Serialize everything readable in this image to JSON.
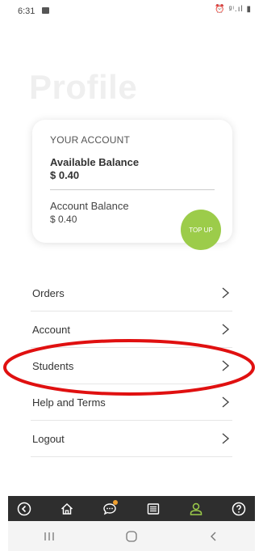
{
  "status_bar": {
    "time": "6:31",
    "right_icons": "⏰ ᵍᶦ.ıl ▮"
  },
  "page": {
    "title": "Profile"
  },
  "account_card": {
    "heading": "YOUR ACCOUNT",
    "available_balance_label": "Available Balance",
    "available_balance_value": "$ 0.40",
    "account_balance_label": "Account Balance",
    "account_balance_value": "$ 0.40",
    "top_up_label": "TOP UP"
  },
  "menu": {
    "items": [
      {
        "label": "Orders"
      },
      {
        "label": "Account"
      },
      {
        "label": "Students"
      },
      {
        "label": "Help and Terms"
      },
      {
        "label": "Logout"
      }
    ]
  },
  "bottom_nav": {
    "items": [
      "back-icon",
      "home-icon",
      "chat-icon",
      "list-icon",
      "profile-icon",
      "help-icon"
    ],
    "active": "profile-icon",
    "active_color": "#9ccc4a"
  },
  "colors": {
    "accent": "#9ccc4a",
    "highlight": "#e01010",
    "nav_bg": "#2e2e2e"
  }
}
